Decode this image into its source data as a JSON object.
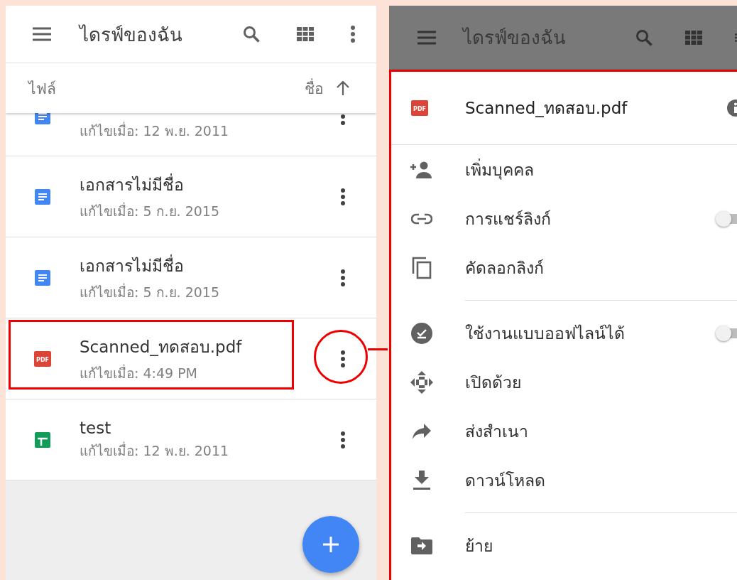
{
  "left_screen": {
    "app_bar": {
      "title": "ไดรฟ์ของฉัน"
    },
    "list_header": {
      "label": "ไฟล์",
      "sort_label": "ชื่อ"
    },
    "partial_row": {
      "kind": "doc",
      "modified": "แก้ไขเมื่อ: 12 พ.ย. 2011"
    },
    "files": [
      {
        "kind": "doc",
        "title": "เอกสารไม่มีชื่อ",
        "modified": "แก้ไขเมื่อ: 5 ก.ย. 2015",
        "highlighted": false
      },
      {
        "kind": "doc",
        "title": "เอกสารไม่มีชื่อ",
        "modified": "แก้ไขเมื่อ: 5 ก.ย. 2015",
        "highlighted": false
      },
      {
        "kind": "pdf",
        "icon_text": "PDF",
        "title": "Scanned_ทดสอบ.pdf",
        "modified": "แก้ไขเมื่อ: 4:49 PM",
        "highlighted": true
      },
      {
        "kind": "sheet",
        "title": "test",
        "modified": "แก้ไขเมื่อ: 12 พ.ย. 2011",
        "highlighted": false
      }
    ]
  },
  "right_screen": {
    "app_bar": {
      "title": "ไดรฟ์ของฉัน"
    },
    "sheet": {
      "icon_text": "PDF",
      "file_title": "Scanned_ทดสอบ.pdf",
      "sections": [
        [
          {
            "kind": "action",
            "label": "เพิ่มบุคคล"
          },
          {
            "kind": "toggle",
            "label": "การแชร์ลิงก์",
            "on": false
          },
          {
            "kind": "action",
            "label": "คัดลอกลิงก์"
          }
        ],
        [
          {
            "kind": "toggle",
            "label": "ใช้งานแบบออฟไลน์ได้",
            "on": false
          },
          {
            "kind": "action",
            "label": "เปิดด้วย"
          },
          {
            "kind": "action",
            "label": "ส่งสำเนา"
          },
          {
            "kind": "action",
            "label": "ดาวน์โหลด"
          }
        ],
        [
          {
            "kind": "action",
            "label": "ย้าย"
          }
        ]
      ]
    }
  }
}
